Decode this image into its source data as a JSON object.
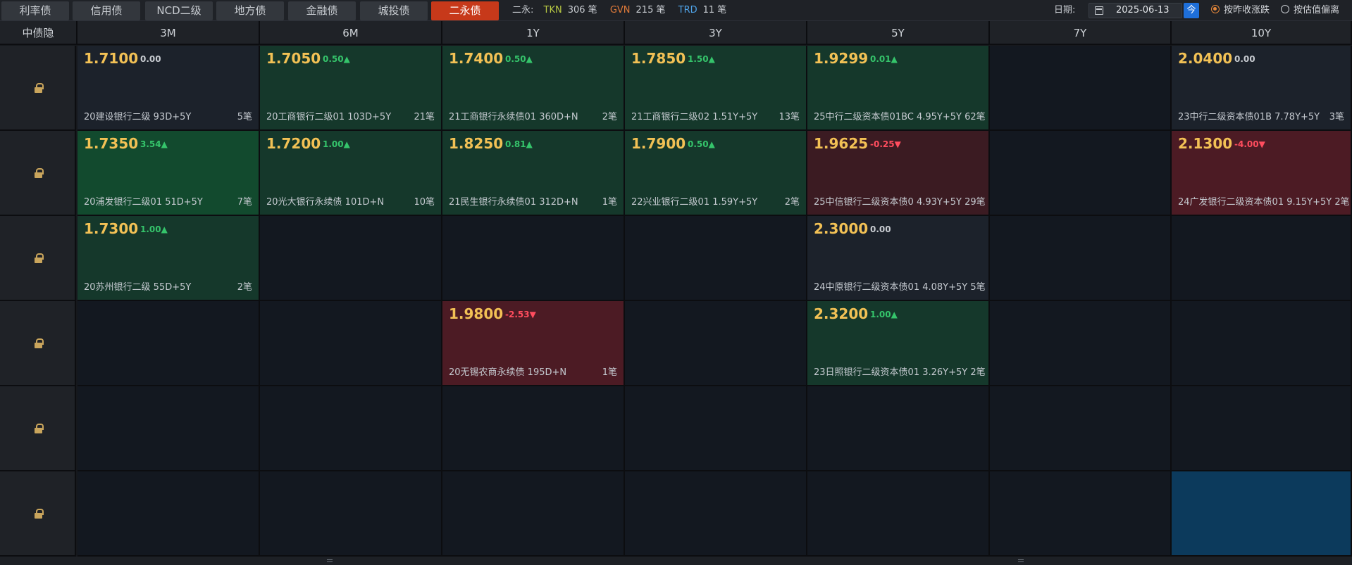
{
  "tabs": [
    "利率债",
    "信用债",
    "NCD二级",
    "地方债",
    "金融债",
    "城投债",
    "二永债"
  ],
  "active_tab": "二永债",
  "stats": {
    "label": "二永:",
    "tkn_key": "TKN",
    "tkn_val": "306 笔",
    "gvn_key": "GVN",
    "gvn_val": "215 笔",
    "trd_key": "TRD",
    "trd_val": "11 笔"
  },
  "date": {
    "label": "日期:",
    "value": "2025-06-13",
    "today": "今"
  },
  "radios": [
    {
      "label": "按昨收涨跌",
      "checked": true
    },
    {
      "label": "按估值偏离",
      "checked": false
    }
  ],
  "corner": "中债隐",
  "columns": [
    "3M",
    "6M",
    "1Y",
    "3Y",
    "5Y",
    "7Y",
    "10Y"
  ],
  "colors": {
    "up": "#35c46b",
    "down": "#ff4d5e",
    "price": "#f2c155",
    "active_tab": "#c7391a",
    "selected": "#0c3a5c"
  },
  "rows": [
    {
      "lock_icon": "lock-icon",
      "cells": [
        {
          "price": "1.7100",
          "change": "0.00",
          "dir": "zero",
          "bg": "flat",
          "desc": "20建设银行二级 93D+5Y",
          "count": "5笔"
        },
        {
          "price": "1.7050",
          "change": "0.50▲",
          "dir": "pos",
          "bg": "up",
          "desc": "20工商银行二级01 103D+5Y",
          "count": "21笔"
        },
        {
          "price": "1.7400",
          "change": "0.50▲",
          "dir": "pos",
          "bg": "up",
          "desc": "21工商银行永续债01 360D+N",
          "count": "2笔"
        },
        {
          "price": "1.7850",
          "change": "1.50▲",
          "dir": "pos",
          "bg": "up",
          "desc": "21工商银行二级02 1.51Y+5Y",
          "count": "13笔"
        },
        {
          "price": "1.9299",
          "change": "0.01▲",
          "dir": "pos",
          "bg": "up",
          "desc": "25中行二级资本债01BC 4.95Y+5Y 62笔",
          "count": ""
        },
        null,
        {
          "price": "2.0400",
          "change": "0.00",
          "dir": "zero",
          "bg": "flat",
          "desc": "23中行二级资本债01B 7.78Y+5Y",
          "count": "3笔"
        }
      ]
    },
    {
      "lock_icon": "lock-icon",
      "cells": [
        {
          "price": "1.7350",
          "change": "3.54▲",
          "dir": "pos",
          "bg": "up2",
          "desc": "20浦发银行二级01 51D+5Y",
          "count": "7笔"
        },
        {
          "price": "1.7200",
          "change": "1.00▲",
          "dir": "pos",
          "bg": "up",
          "desc": "20光大银行永续债 101D+N",
          "count": "10笔"
        },
        {
          "price": "1.8250",
          "change": "0.81▲",
          "dir": "pos",
          "bg": "up",
          "desc": "21民生银行永续债01 312D+N",
          "count": "1笔"
        },
        {
          "price": "1.7900",
          "change": "0.50▲",
          "dir": "pos",
          "bg": "up",
          "desc": "22兴业银行二级01 1.59Y+5Y",
          "count": "2笔"
        },
        {
          "price": "1.9625",
          "change": "-0.25▼",
          "dir": "neg",
          "bg": "down",
          "desc": "25中信银行二级资本债0 4.93Y+5Y 29笔",
          "count": ""
        },
        null,
        {
          "price": "2.1300",
          "change": "-4.00▼",
          "dir": "neg",
          "bg": "down2",
          "desc": "24广发银行二级资本债01 9.15Y+5Y 2笔",
          "count": ""
        }
      ]
    },
    {
      "lock_icon": "lock-icon",
      "cells": [
        {
          "price": "1.7300",
          "change": "1.00▲",
          "dir": "pos",
          "bg": "up",
          "desc": "20苏州银行二级 55D+5Y",
          "count": "2笔"
        },
        null,
        null,
        null,
        {
          "price": "2.3000",
          "change": "0.00",
          "dir": "zero",
          "bg": "flat",
          "desc": "24中原银行二级资本债01 4.08Y+5Y 5笔",
          "count": ""
        },
        null,
        null
      ]
    },
    {
      "lock_icon": "lock-icon",
      "cells": [
        null,
        null,
        {
          "price": "1.9800",
          "change": "-2.53▼",
          "dir": "neg",
          "bg": "down2",
          "desc": "20无锡农商永续债 195D+N",
          "count": "1笔"
        },
        null,
        {
          "price": "2.3200",
          "change": "1.00▲",
          "dir": "pos",
          "bg": "up",
          "desc": "23日照银行二级资本债01 3.26Y+5Y 2笔",
          "count": ""
        },
        null,
        null
      ]
    },
    {
      "lock_icon": "lock-icon",
      "cells": [
        null,
        null,
        null,
        null,
        null,
        null,
        null
      ]
    },
    {
      "lock_icon": "lock-icon",
      "cells": [
        null,
        null,
        null,
        null,
        null,
        null,
        "selected"
      ]
    }
  ]
}
